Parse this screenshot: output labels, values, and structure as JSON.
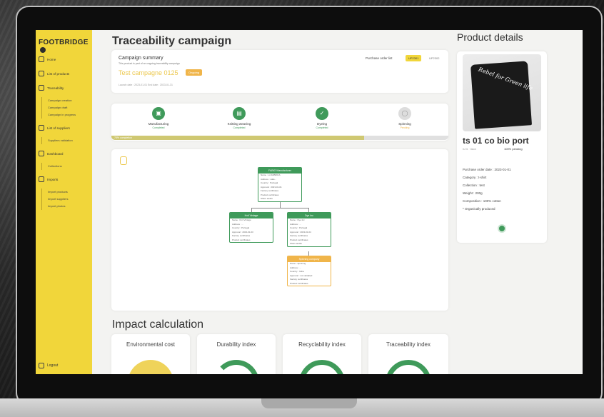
{
  "app": {
    "logo_text": "FOOTBRIDGE"
  },
  "sidebar": {
    "items": [
      {
        "label": "Home"
      },
      {
        "label": "List of products"
      },
      {
        "label": "Traceability"
      },
      {
        "label": "Campaign creation",
        "sub": true
      },
      {
        "label": "Campaign draft",
        "sub": true
      },
      {
        "label": "Campaign in progress",
        "sub": true
      },
      {
        "label": "List of suppliers"
      },
      {
        "label": "Suppliers validation",
        "sub": true
      },
      {
        "label": "Dashboard"
      },
      {
        "label": "Collections",
        "sub": true
      },
      {
        "label": "Imports"
      },
      {
        "label": "Import products",
        "sub": true
      },
      {
        "label": "Import suppliers",
        "sub": true
      },
      {
        "label": "Import photos",
        "sub": true
      }
    ],
    "logout": "Logout"
  },
  "main": {
    "title": "Traceability campaign",
    "summary": {
      "title": "Campaign summary",
      "subtitle": "This product is part of an ongoing traceability campaign",
      "campaign_name": "Test campagne 0125",
      "campaign_status": "Ongoing",
      "dates": "Launch date : 2023-01-01     End date : 2023-01-31",
      "po_label": "Purchase order list",
      "po_value": "UP2301",
      "po_extra": "UP2302"
    },
    "steps": [
      {
        "label": "Manufacturing",
        "status": "Completed",
        "done": true
      },
      {
        "label": "Knitting weaving",
        "status": "Completed",
        "done": true
      },
      {
        "label": "Dyeing",
        "status": "Completed",
        "done": true
      },
      {
        "label": "Spinning",
        "status": "Pending",
        "done": false
      }
    ],
    "progress": {
      "value": 0.75,
      "text": "75% completion"
    },
    "tree": {
      "nodes": [
        {
          "title": "FABIO Manufacturer",
          "lines": [
            "Name : LA FABRICA",
            "Address : calle...",
            "Country : Portugal",
            "Approval : 2023-01-01",
            "Factory certificates",
            "Product certificates",
            "Share audits"
          ]
        },
        {
          "title": "Knit Vintage",
          "lines": [
            "Name : Knit Vintage",
            "Address : ...",
            "Country : Portugal",
            "Approval : 2023-01-03",
            "Factory certificates",
            "Product certificates"
          ]
        },
        {
          "title": "Dye Inc",
          "lines": [
            "Name : Dye Inc",
            "Address : ...",
            "Country : Portugal",
            "Approval : 2023-01-04",
            "Factory certificates",
            "Product certificates",
            "Share audits"
          ]
        },
        {
          "title": "Spinning company",
          "lines": [
            "Name : Spinning",
            "Address : ...",
            "Country : India",
            "Approval : not validated",
            "Factory certificates",
            "Product certificates"
          ]
        }
      ]
    }
  },
  "impact": {
    "title": "Impact calculation",
    "metrics": [
      {
        "label": "Environmental cost"
      },
      {
        "label": "Durability index"
      },
      {
        "label": "Recyclability index"
      },
      {
        "label": "Traceability index"
      }
    ]
  },
  "product": {
    "title": "Product details",
    "image_text": "Rebel for Green life",
    "name": "ts 01 co bio port",
    "sub": "ts 01 · black",
    "tag": "100% pending",
    "info": [
      "Purchase order date : 2023-01-01",
      "Category : t-shirt",
      "Collection : test",
      "Weight : 200g",
      "Composition : 100% cotton",
      "* Organically produced"
    ]
  },
  "colors": {
    "accent": "#f1d63a",
    "green": "#3f9a5a",
    "orange": "#f0b54a"
  }
}
